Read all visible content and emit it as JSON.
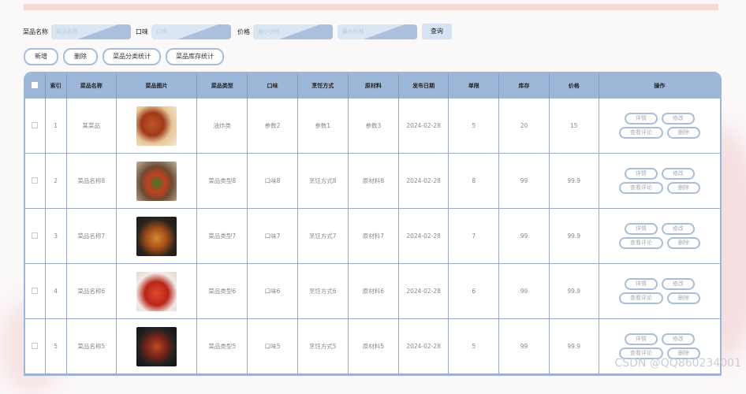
{
  "search": {
    "name_label": "菜品名称",
    "name_placeholder": "菜品名称",
    "taste_label": "口味",
    "taste_placeholder": "口味",
    "price_label": "价格",
    "min_price_placeholder": "最小价格",
    "max_price_placeholder": "最大价格",
    "query_button": "查询"
  },
  "toolbar": {
    "add": "新增",
    "delete": "删除",
    "category_stats": "菜品分类统计",
    "stock_stats": "菜品库存统计"
  },
  "table": {
    "headers": [
      "索引",
      "菜品名称",
      "菜品图片",
      "菜品类型",
      "口味",
      "烹饪方式",
      "原材料",
      "发布日期",
      "单限",
      "库存",
      "价格",
      "操作"
    ],
    "rows": [
      {
        "index": "1",
        "name": "某菜品",
        "type": "油炸类",
        "taste": "参数2",
        "cook": "参数1",
        "material": "参数3",
        "date": "2024-02-28",
        "limit": "5",
        "stock": "20",
        "price": "15",
        "img": "chicken"
      },
      {
        "index": "2",
        "name": "菜品名称8",
        "type": "菜品类型8",
        "taste": "口味8",
        "cook": "烹饪方式8",
        "material": "原材料8",
        "date": "2024-02-28",
        "limit": "8",
        "stock": "99",
        "price": "99.9",
        "img": "stirfry"
      },
      {
        "index": "3",
        "name": "菜品名称7",
        "type": "菜品类型7",
        "taste": "口味7",
        "cook": "烹饪方式7",
        "material": "原材料7",
        "date": "2024-02-28",
        "limit": "7",
        "stock": "99",
        "price": "99.9",
        "img": "pot"
      },
      {
        "index": "4",
        "name": "菜品名称6",
        "type": "菜品类型6",
        "taste": "口味6",
        "cook": "烹饪方式6",
        "material": "原材料6",
        "date": "2024-02-28",
        "limit": "6",
        "stock": "99",
        "price": "99.9",
        "img": "crawfish"
      },
      {
        "index": "5",
        "name": "菜品名称5",
        "type": "菜品类型5",
        "taste": "口味5",
        "cook": "烹饪方式5",
        "material": "原材料5",
        "date": "2024-02-28",
        "limit": "5",
        "stock": "99",
        "price": "99.9",
        "img": "soup"
      }
    ],
    "row_actions": {
      "detail": "详情",
      "edit": "修改",
      "review": "查看评论",
      "remove": "删除"
    }
  },
  "watermark": "CSDN @QQ860234001",
  "colors": {
    "header_bg": "#9db7d9",
    "accent_border": "#a9bdd9",
    "top_bar": "#f7d9d4"
  }
}
